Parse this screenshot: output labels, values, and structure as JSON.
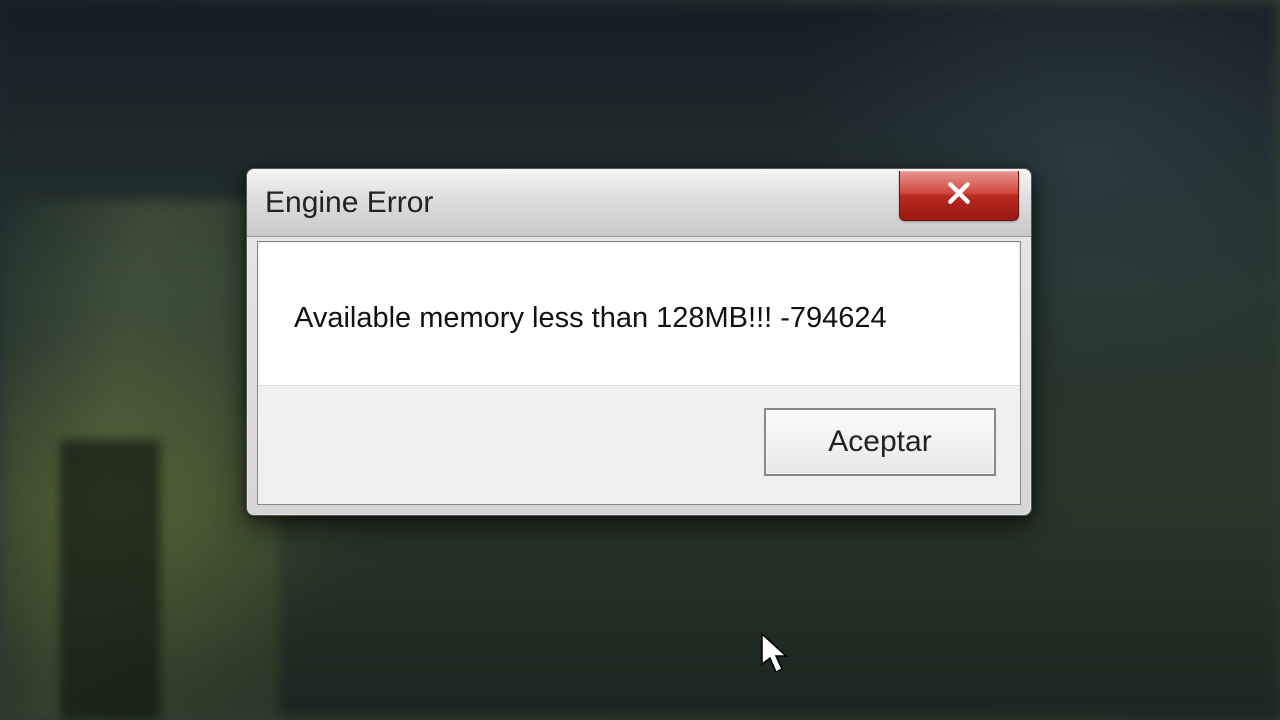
{
  "dialog": {
    "title": "Engine Error",
    "message": "Available memory less than 128MB!!! -794624",
    "accept_label": "Aceptar"
  }
}
